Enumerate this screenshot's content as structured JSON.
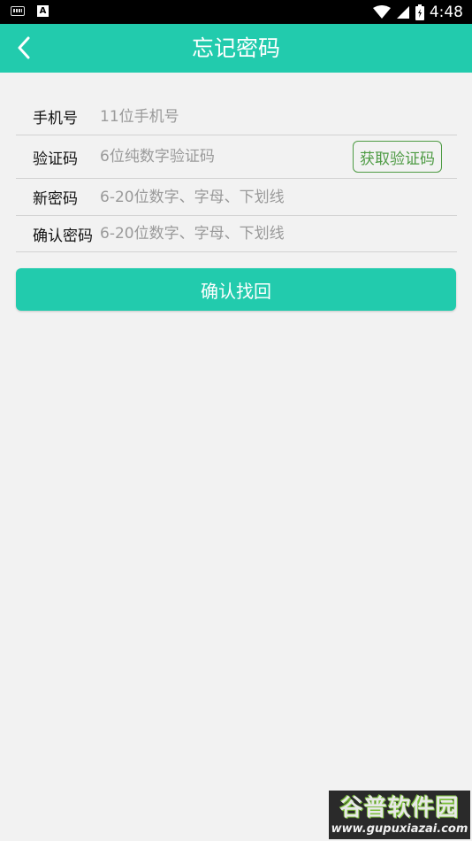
{
  "status_bar": {
    "time": "4:48",
    "notification_letter": "A"
  },
  "app_bar": {
    "title": "忘记密码"
  },
  "form": {
    "phone": {
      "label": "手机号",
      "placeholder": "11位手机号",
      "value": ""
    },
    "code": {
      "label": "验证码",
      "placeholder": "6位纯数字验证码",
      "value": "",
      "get_code_label": "获取验证码"
    },
    "new_password": {
      "label": "新密码",
      "placeholder": "6-20位数字、字母、下划线",
      "value": ""
    },
    "confirm_password": {
      "label": "确认密码",
      "placeholder": "6-20位数字、字母、下划线",
      "value": ""
    }
  },
  "submit_label": "确认找回",
  "watermark": {
    "brand": "谷普软件园",
    "url": "www.gupuxiazai.com"
  },
  "colors": {
    "accent": "#22cbad",
    "code_button": "#4e9b44",
    "background": "#f2f2f2"
  },
  "icons": {
    "back": "chevron-left-icon",
    "wifi": "wifi-icon",
    "signal": "signal-icon",
    "battery": "battery-icon",
    "keyboard": "keyboard-icon"
  }
}
